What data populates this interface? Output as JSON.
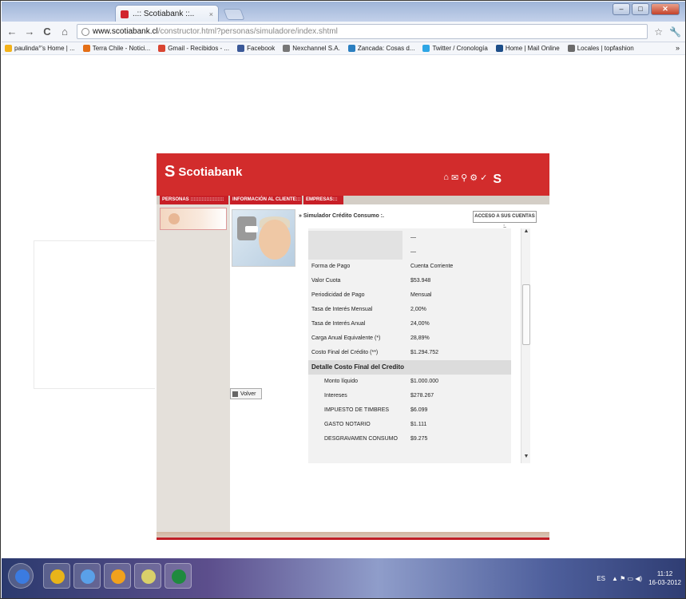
{
  "browser": {
    "tab_title": "..:: Scotiabank ::..",
    "tab_close": "×",
    "url_host": "www.scotiabank.cl",
    "url_path": "/constructor.html?personas/simuladore/index.shtml",
    "back_icon": "←",
    "forward_icon": "→",
    "reload_icon": "C",
    "home_icon": "⌂",
    "star_icon": "☆",
    "wrench_icon": "🔧",
    "window_buttons": [
      "–",
      "□",
      "✕"
    ],
    "bookmarks": [
      {
        "label": "paulinda°'s Home | ...",
        "color": "#f3b21a"
      },
      {
        "label": "Terra Chile - Notici...",
        "color": "#e46f17"
      },
      {
        "label": "Gmail - Recibidos - ...",
        "color": "#d94532"
      },
      {
        "label": "Facebook",
        "color": "#3b5998"
      },
      {
        "label": "Nexchannel S.A.",
        "color": "#777777"
      },
      {
        "label": "Zancada: Cosas d...",
        "color": "#2b7fc0"
      },
      {
        "label": "Twitter / Cronología",
        "color": "#2ea6e5"
      },
      {
        "label": "Home | Mail Online",
        "color": "#1d4e89"
      },
      {
        "label": "Locales | topfashion",
        "color": "#6b6b6b"
      }
    ],
    "bookmarks_more": "»"
  },
  "site": {
    "brand": "Scotiabank",
    "brand_mark": "S",
    "header_icons": [
      "⌂",
      "✉",
      "⚲",
      "⚙",
      "✓"
    ],
    "nav": {
      "personas": "PERSONAS :::::::::::::::::::::",
      "informacion": "INFORMACIÓN AL CLIENTE:::",
      "empresas": "EMPRESAS:::"
    },
    "page_title": "» Simulador Crédito Consumo :.",
    "acceso_button": "ACCESO A SUS CUENTAS :.",
    "volver_button": "Volver",
    "scroll_up": "▲",
    "scroll_down": "▼",
    "rows": [
      {
        "label": "",
        "value": "—",
        "kind": "blank"
      },
      {
        "label": "",
        "value": "—",
        "kind": "blank"
      },
      {
        "label": "Forma de Pago",
        "value": "Cuenta Corriente",
        "kind": "normal"
      },
      {
        "label": "Valor Cuota",
        "value": "$53.948",
        "kind": "normal"
      },
      {
        "label": "Periodicidad de Pago",
        "value": "Mensual",
        "kind": "normal"
      },
      {
        "label": "Tasa de Interés Mensual",
        "value": "2,00%",
        "kind": "normal"
      },
      {
        "label": "Tasa de Interés Anual",
        "value": "24,00%",
        "kind": "normal"
      },
      {
        "label": "Carga Anual Equivalente (*)",
        "value": "28,89%",
        "kind": "normal"
      },
      {
        "label": "Costo Final del Crédito (**)",
        "value": "$1.294.752",
        "kind": "normal"
      },
      {
        "label": "Detalle Costo Final del Credito",
        "value": "",
        "kind": "hdr"
      },
      {
        "label": "Monto líquido",
        "value": "$1.000.000",
        "kind": "sub"
      },
      {
        "label": "Intereses",
        "value": "$278.267",
        "kind": "sub"
      },
      {
        "label": "IMPUESTO DE TIMBRES",
        "value": "$6.099",
        "kind": "sub"
      },
      {
        "label": "GASTO NOTARIO",
        "value": "$1.111",
        "kind": "sub"
      },
      {
        "label": "DESGRAVAMEN CONSUMO",
        "value": "$9.275",
        "kind": "sub"
      }
    ]
  },
  "taskbar": {
    "apps": [
      {
        "name": "start",
        "color": "#3b7be0"
      },
      {
        "name": "chrome",
        "color": "#e8b41a"
      },
      {
        "name": "itunes",
        "color": "#5aa0e8"
      },
      {
        "name": "internet",
        "color": "#f0a11d"
      },
      {
        "name": "notes",
        "color": "#d9d06a"
      },
      {
        "name": "excel",
        "color": "#1f8a3f"
      }
    ],
    "lang": "ES",
    "tray_icons": "▲ ⚑ ▭ ◀)",
    "time": "11:12",
    "date": "16-03-2012"
  }
}
